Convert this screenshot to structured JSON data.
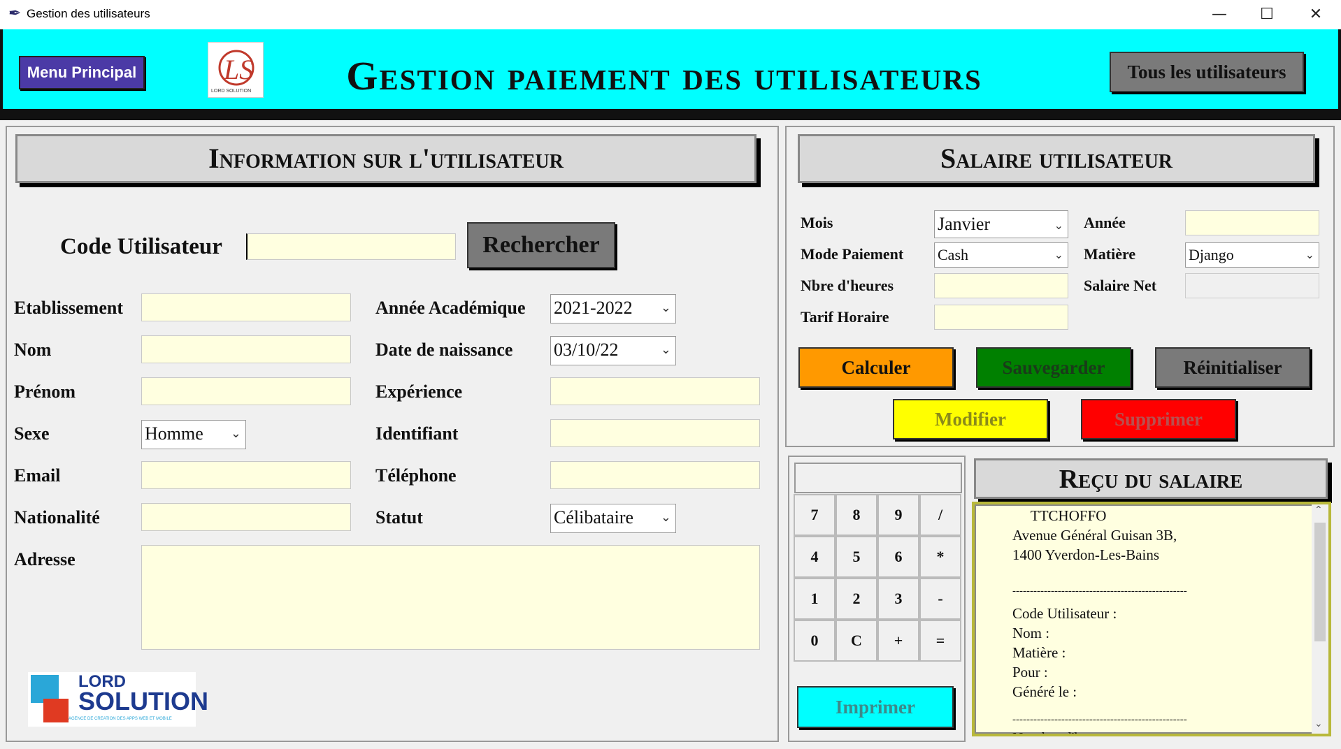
{
  "window": {
    "title": "Gestion des utilisateurs",
    "minimize": "—",
    "maximize": "☐",
    "close": "✕"
  },
  "header": {
    "menu_label": "Menu Principal",
    "title": "Gestion paiement des utilisateurs",
    "all_users_label": "Tous les utilisateurs",
    "logo_text": "LORD SOLUTION"
  },
  "user_info": {
    "heading": "Information sur l'utilisateur",
    "code_label": "Code Utilisateur",
    "code_value": "",
    "search_label": "Rechercher",
    "labels": {
      "etablissement": "Etablissement",
      "nom": "Nom",
      "prenom": "Prénom",
      "sexe": "Sexe",
      "email": "Email",
      "nationalite": "Nationalité",
      "adresse": "Adresse",
      "annee_academique": "Année Académique",
      "date_naissance": "Date de naissance",
      "experience": "Expérience",
      "identifiant": "Identifiant",
      "telephone": "Téléphone",
      "statut": "Statut"
    },
    "values": {
      "sexe": "Homme",
      "annee_academique": "2021-2022",
      "date_naissance": "03/10/22",
      "statut": "Célibataire"
    },
    "bottom_logo": {
      "line1": "LORD",
      "line2": "SOLUTION",
      "tagline": "AGENCE DE CREATION DES APPS WEB ET MOBILE"
    }
  },
  "salary": {
    "heading": "Salaire utilisateur",
    "labels": {
      "mois": "Mois",
      "mode_paiement": "Mode Paiement",
      "nbre_heures": "Nbre d'heures",
      "tarif_horaire": "Tarif Horaire",
      "annee": "Année",
      "matiere": "Matière",
      "salaire_net": "Salaire Net"
    },
    "values": {
      "mois": "Janvier",
      "mode_paiement": "Cash",
      "matiere": "Django"
    },
    "buttons": {
      "calculer": "Calculer",
      "sauvegarder": "Sauvegarder",
      "reinitialiser": "Réinitialiser",
      "modifier": "Modifier",
      "supprimer": "Supprimer"
    },
    "colors": {
      "calculer": "#ff9900",
      "sauvegarder": "#008000",
      "reinitialiser": "#7a7a7a",
      "modifier": "#ffff00",
      "supprimer": "#ff0000"
    }
  },
  "calculator": {
    "keys": [
      "7",
      "8",
      "9",
      "/",
      "4",
      "5",
      "6",
      "*",
      "1",
      "2",
      "3",
      "-",
      "0",
      "C",
      "+",
      "="
    ],
    "print_label": "Imprimer"
  },
  "receipt": {
    "heading": "Reçu du salaire",
    "lines": [
      "     TTCHOFFO",
      "Avenue Général Guisan 3B,",
      "1400 Yverdon-Les-Bains",
      "",
      "--------------------------------------------------",
      "Code Utilisateur :",
      "Nom :",
      "Matière :",
      "Pour :",
      "Généré le :",
      "",
      "--------------------------------------------------",
      "Nombre d'h"
    ]
  }
}
